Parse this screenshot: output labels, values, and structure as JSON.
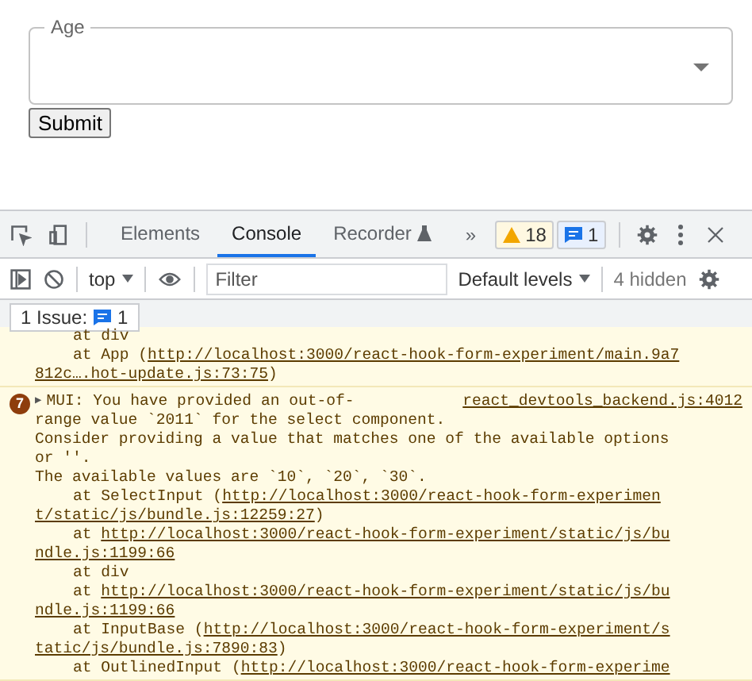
{
  "form": {
    "select": {
      "label": "Age"
    },
    "submit": "Submit"
  },
  "devtools": {
    "tabs": [
      {
        "label": "Elements",
        "selected": false
      },
      {
        "label": "Console",
        "selected": true
      },
      {
        "label": "Recorder",
        "selected": false
      }
    ],
    "more": "»",
    "warnings": "18",
    "infos": "1",
    "console_toolbar": {
      "context": "top",
      "filter_placeholder": "Filter",
      "levels": "Default levels",
      "hidden": "4 hidden"
    },
    "issues": {
      "label": "1 Issue:",
      "count": "1"
    },
    "messages": [
      {
        "lines": [
          {
            "indent": true,
            "segments": [
              {
                "text": "at div",
                "link": false
              }
            ]
          },
          {
            "indent": true,
            "segments": [
              {
                "text": "at App (",
                "link": false
              },
              {
                "text": "http://localhost:3000/react-hook-form-experiment/main.9a7",
                "link": true
              }
            ]
          },
          {
            "indent": false,
            "segments": [
              {
                "text": "812c….hot-update.js:73:75",
                "link": true
              },
              {
                "text": ")",
                "link": false
              }
            ]
          }
        ]
      },
      {
        "count": "7",
        "toggle": "▶",
        "source": "react_devtools_backend.js:4012",
        "lines": [
          {
            "indent": false,
            "segments": [
              {
                "text": "MUI: You have provided an out-of-",
                "link": false
              }
            ]
          },
          {
            "indent": false,
            "segments": [
              {
                "text": "range value `2011` for the select component.",
                "link": false
              }
            ]
          },
          {
            "indent": false,
            "segments": [
              {
                "text": "Consider providing a value that matches one of the available options",
                "link": false
              }
            ]
          },
          {
            "indent": false,
            "segments": [
              {
                "text": "or ''.",
                "link": false
              }
            ]
          },
          {
            "indent": false,
            "segments": [
              {
                "text": "The available values are `10`, `20`, `30`.",
                "link": false
              }
            ]
          },
          {
            "indent": true,
            "segments": [
              {
                "text": "at SelectInput (",
                "link": false
              },
              {
                "text": "http://localhost:3000/react-hook-form-experimen",
                "link": true
              }
            ]
          },
          {
            "indent": false,
            "segments": [
              {
                "text": "t/static/js/bundle.js:12259:27",
                "link": true
              },
              {
                "text": ")",
                "link": false
              }
            ]
          },
          {
            "indent": true,
            "segments": [
              {
                "text": "at ",
                "link": false
              },
              {
                "text": "http://localhost:3000/react-hook-form-experiment/static/js/bu",
                "link": true
              }
            ]
          },
          {
            "indent": false,
            "segments": [
              {
                "text": "ndle.js:1199:66",
                "link": true
              }
            ]
          },
          {
            "indent": true,
            "segments": [
              {
                "text": "at div",
                "link": false
              }
            ]
          },
          {
            "indent": true,
            "segments": [
              {
                "text": "at ",
                "link": false
              },
              {
                "text": "http://localhost:3000/react-hook-form-experiment/static/js/bu",
                "link": true
              }
            ]
          },
          {
            "indent": false,
            "segments": [
              {
                "text": "ndle.js:1199:66",
                "link": true
              }
            ]
          },
          {
            "indent": true,
            "segments": [
              {
                "text": "at InputBase (",
                "link": false
              },
              {
                "text": "http://localhost:3000/react-hook-form-experiment/s",
                "link": true
              }
            ]
          },
          {
            "indent": false,
            "segments": [
              {
                "text": "tatic/js/bundle.js:7890:83",
                "link": true
              },
              {
                "text": ")",
                "link": false
              }
            ]
          },
          {
            "indent": true,
            "segments": [
              {
                "text": "at OutlinedInput (",
                "link": false
              },
              {
                "text": "http://localhost:3000/react-hook-form-experime",
                "link": true
              }
            ]
          }
        ]
      }
    ]
  }
}
